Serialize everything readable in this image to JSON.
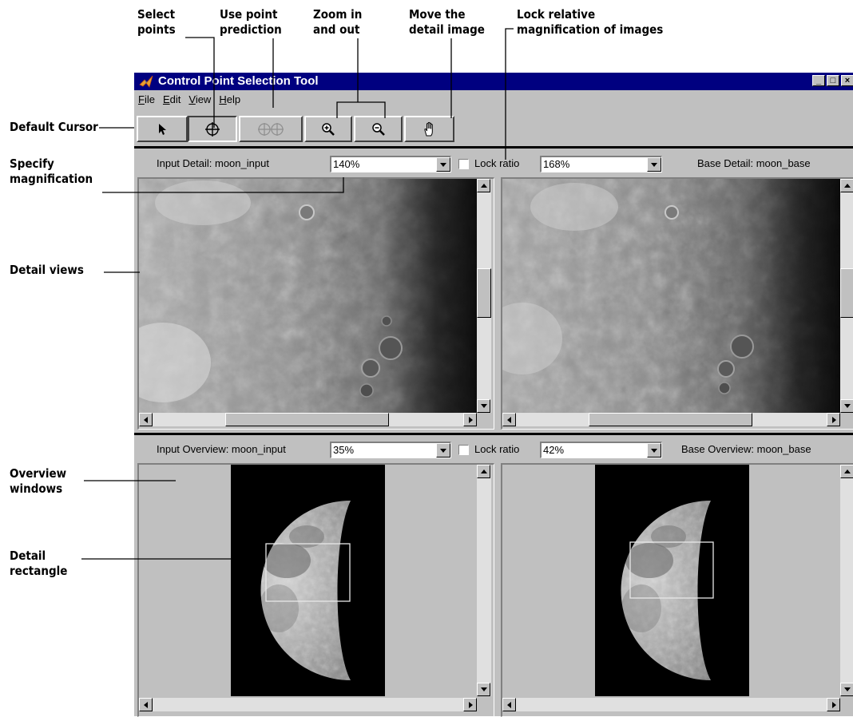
{
  "callouts": {
    "select_points": "Select\npoints",
    "use_point_prediction": "Use point\nprediction",
    "zoom": "Zoom in\nand out",
    "move_detail": "Move the\ndetail image",
    "lock_relative": "Lock relative\nmagnification of images",
    "default_cursor": "Default Cursor",
    "specify_magnification": "Specify\nmagnification",
    "detail_views": "Detail views",
    "overview_windows": "Overview\nwindows",
    "detail_rectangle": "Detail\nrectangle"
  },
  "window": {
    "title": "Control Point Selection Tool",
    "controls": [
      "_",
      "□",
      "×"
    ]
  },
  "menu": [
    {
      "mnemonic": "F",
      "rest": "ile"
    },
    {
      "mnemonic": "E",
      "rest": "dit"
    },
    {
      "mnemonic": "V",
      "rest": "iew"
    },
    {
      "mnemonic": "H",
      "rest": "elp"
    }
  ],
  "toolbar": {
    "icons": [
      "arrow-cursor-icon",
      "crosshair-icon",
      "double-crosshair-icon",
      "zoom-in-icon",
      "zoom-out-icon",
      "hand-icon"
    ]
  },
  "detail": {
    "input_label": "Input Detail: moon_input",
    "input_mag": "140%",
    "lock_label": "Lock ratio",
    "base_mag": "168%",
    "base_label": "Base Detail: moon_base"
  },
  "overview": {
    "input_label": "Input Overview: moon_input",
    "input_mag": "35%",
    "lock_label": "Lock ratio",
    "base_mag": "42%",
    "base_label": "Base Overview: moon_base"
  }
}
